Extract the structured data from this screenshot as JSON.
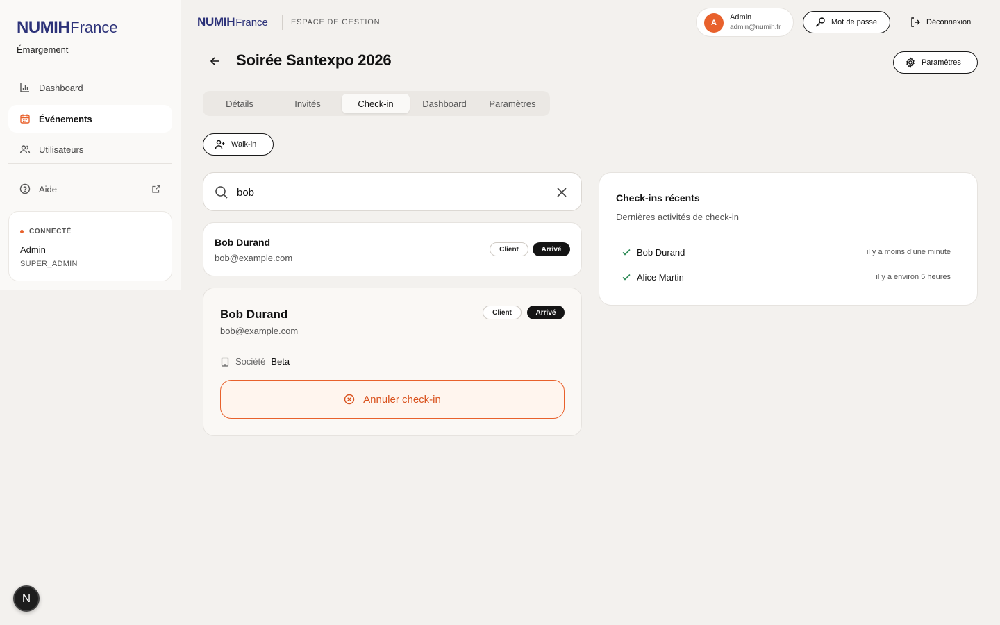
{
  "sidebar": {
    "logo_bold": "NUMIH",
    "logo_light": "France",
    "subtitle": "Émargement",
    "items": [
      {
        "label": "Dashboard",
        "icon": "bar-chart-icon"
      },
      {
        "label": "Événements",
        "icon": "calendar-icon"
      },
      {
        "label": "Utilisateurs",
        "icon": "users-icon"
      }
    ],
    "help": {
      "label": "Aide",
      "icon": "help-circle-icon"
    },
    "status": {
      "label": "CONNECTÉ",
      "name": "Admin",
      "role": "SUPER_ADMIN"
    }
  },
  "header": {
    "logo_bold": "NUMIH",
    "logo_light": "France",
    "space_label": "ESPACE DE GESTION",
    "user": {
      "initial": "A",
      "name": "Admin",
      "email": "admin@numih.fr"
    },
    "password_label": "Mot de passe",
    "logout_label": "Déconnexion"
  },
  "page": {
    "title": "Soirée Santexpo 2026",
    "settings_label": "Paramètres",
    "tabs": [
      {
        "label": "Détails"
      },
      {
        "label": "Invités"
      },
      {
        "label": "Check-in"
      },
      {
        "label": "Dashboard"
      },
      {
        "label": "Paramètres"
      }
    ],
    "active_tab": "Check-in",
    "walkin_label": "Walk-in"
  },
  "search": {
    "value": "bob"
  },
  "result": {
    "name": "Bob Durand",
    "email": "bob@example.com",
    "badge_type": "Client",
    "badge_status": "Arrivé"
  },
  "detail": {
    "name": "Bob Durand",
    "email": "bob@example.com",
    "badge_type": "Client",
    "badge_status": "Arrivé",
    "company_label": "Société",
    "company_value": "Beta",
    "cancel_label": "Annuler check-in"
  },
  "recent": {
    "title": "Check-ins récents",
    "subtitle": "Dernières activités de check-in",
    "items": [
      {
        "name": "Bob Durand",
        "time": "il y a moins d’une minute"
      },
      {
        "name": "Alice Martin",
        "time": "il y a environ 5 heures"
      }
    ]
  },
  "fab": {
    "label": "N"
  },
  "colors": {
    "brand": "#2c3279",
    "accent": "#e8612c",
    "background": "#f3f1ee"
  }
}
